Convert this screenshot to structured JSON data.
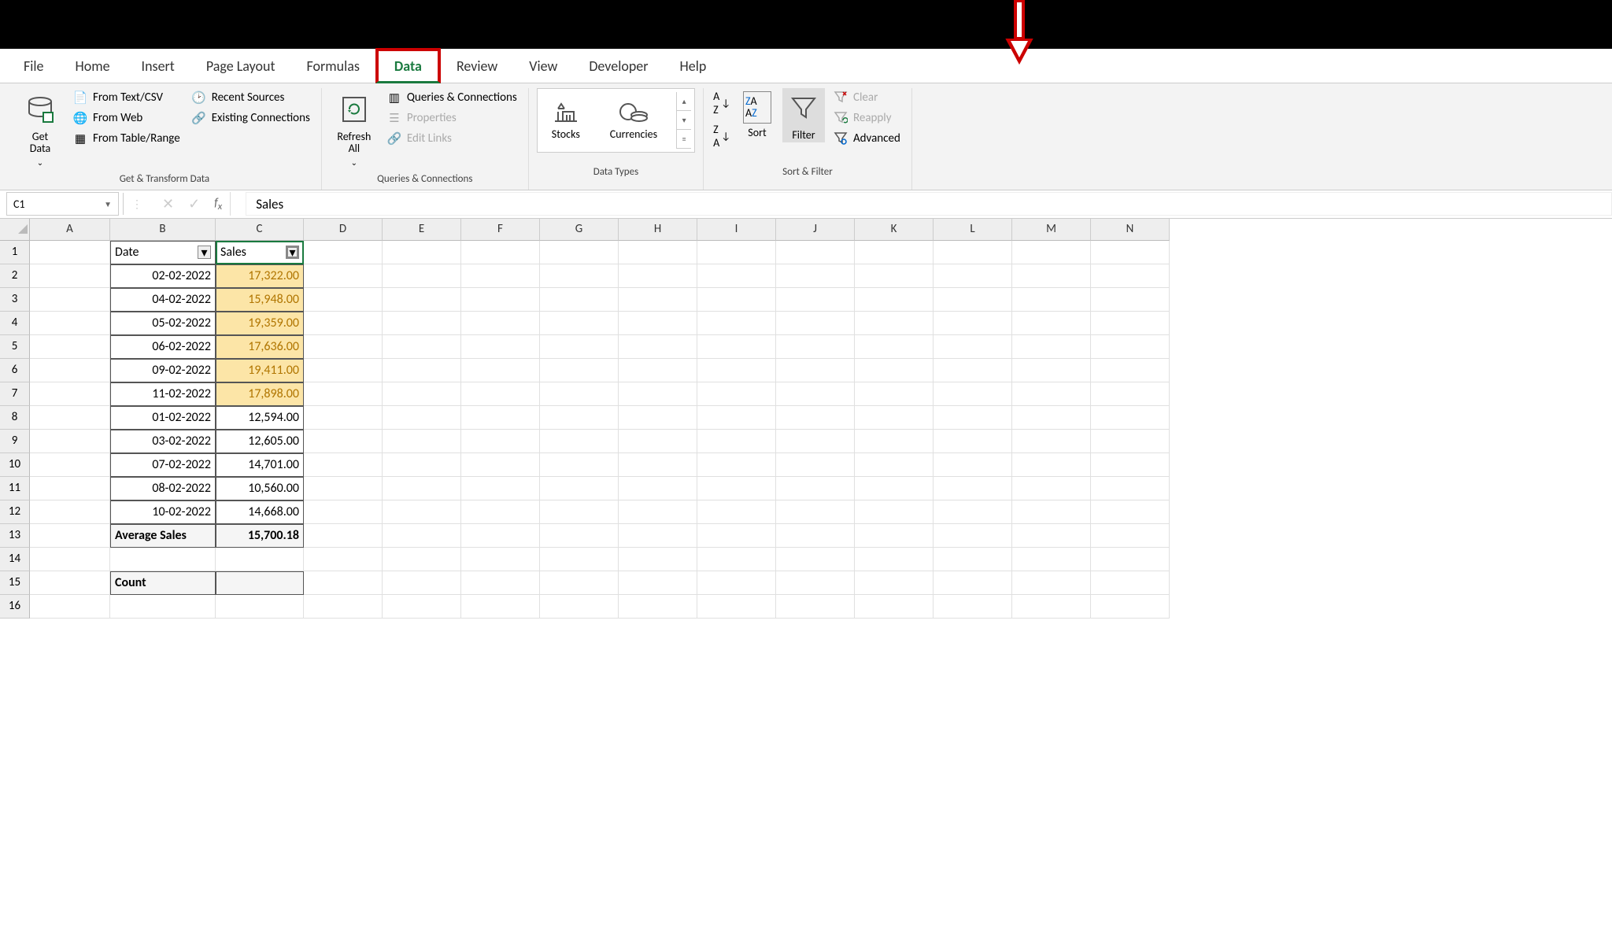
{
  "tabs": {
    "file": "File",
    "home": "Home",
    "insert": "Insert",
    "page_layout": "Page Layout",
    "formulas": "Formulas",
    "data": "Data",
    "review": "Review",
    "view": "View",
    "developer": "Developer",
    "help": "Help"
  },
  "ribbon": {
    "get_data": "Get\nData",
    "from_text_csv": "From Text/CSV",
    "from_web": "From Web",
    "from_table": "From Table/Range",
    "recent_sources": "Recent Sources",
    "existing_conn": "Existing Connections",
    "group1": "Get & Transform Data",
    "refresh_all": "Refresh\nAll",
    "queries_conn": "Queries & Connections",
    "properties": "Properties",
    "edit_links": "Edit Links",
    "group2": "Queries & Connections",
    "stocks": "Stocks",
    "currencies": "Currencies",
    "group3": "Data Types",
    "sort": "Sort",
    "filter": "Filter",
    "clear": "Clear",
    "reapply": "Reapply",
    "advanced": "Advanced",
    "group4": "Sort & Filter"
  },
  "formula_bar": {
    "name_box": "C1",
    "formula": "Sales"
  },
  "columns": [
    "A",
    "B",
    "C",
    "D",
    "E",
    "F",
    "G",
    "H",
    "I",
    "J",
    "K",
    "L",
    "M",
    "N"
  ],
  "rows_count": 16,
  "table": {
    "header_b": "Date",
    "header_c": "Sales",
    "data": [
      {
        "date": "02-02-2022",
        "sales": "17,322.00",
        "hl": true
      },
      {
        "date": "04-02-2022",
        "sales": "15,948.00",
        "hl": true
      },
      {
        "date": "05-02-2022",
        "sales": "19,359.00",
        "hl": true
      },
      {
        "date": "06-02-2022",
        "sales": "17,636.00",
        "hl": true
      },
      {
        "date": "09-02-2022",
        "sales": "19,411.00",
        "hl": true
      },
      {
        "date": "11-02-2022",
        "sales": "17,898.00",
        "hl": true
      },
      {
        "date": "01-02-2022",
        "sales": "12,594.00",
        "hl": false
      },
      {
        "date": "03-02-2022",
        "sales": "12,605.00",
        "hl": false
      },
      {
        "date": "07-02-2022",
        "sales": "14,701.00",
        "hl": false
      },
      {
        "date": "08-02-2022",
        "sales": "10,560.00",
        "hl": false
      },
      {
        "date": "10-02-2022",
        "sales": "14,668.00",
        "hl": false
      }
    ],
    "avg_label": "Average Sales",
    "avg_value": "15,700.18",
    "count_label": "Count"
  }
}
